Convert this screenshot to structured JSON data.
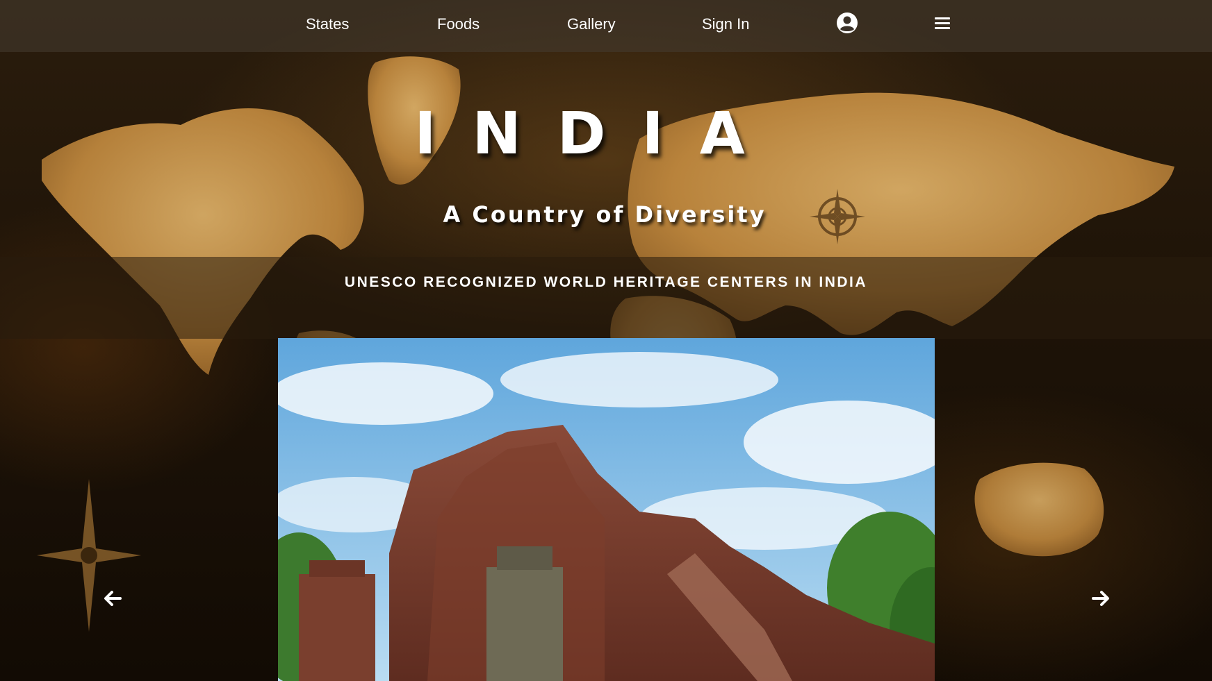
{
  "nav": {
    "links": [
      {
        "label": "States"
      },
      {
        "label": "Foods"
      },
      {
        "label": "Gallery"
      },
      {
        "label": "Sign In"
      }
    ],
    "icons": {
      "account": "user-circle-icon",
      "menu": "hamburger-menu-icon"
    }
  },
  "hero": {
    "title": "INDIA",
    "subtitle": "A Country of Diversity"
  },
  "heritage": {
    "heading": "UNESCO RECOGNIZED WORLD HERITAGE CENTERS IN INDIA",
    "slide_image": "nalanda-ruins-photo",
    "prev_icon": "arrow-left-icon",
    "next_icon": "arrow-right-icon"
  },
  "colors": {
    "text": "#ffffff",
    "map_gold": "#c9954a",
    "background_dark": "#1a1008"
  }
}
